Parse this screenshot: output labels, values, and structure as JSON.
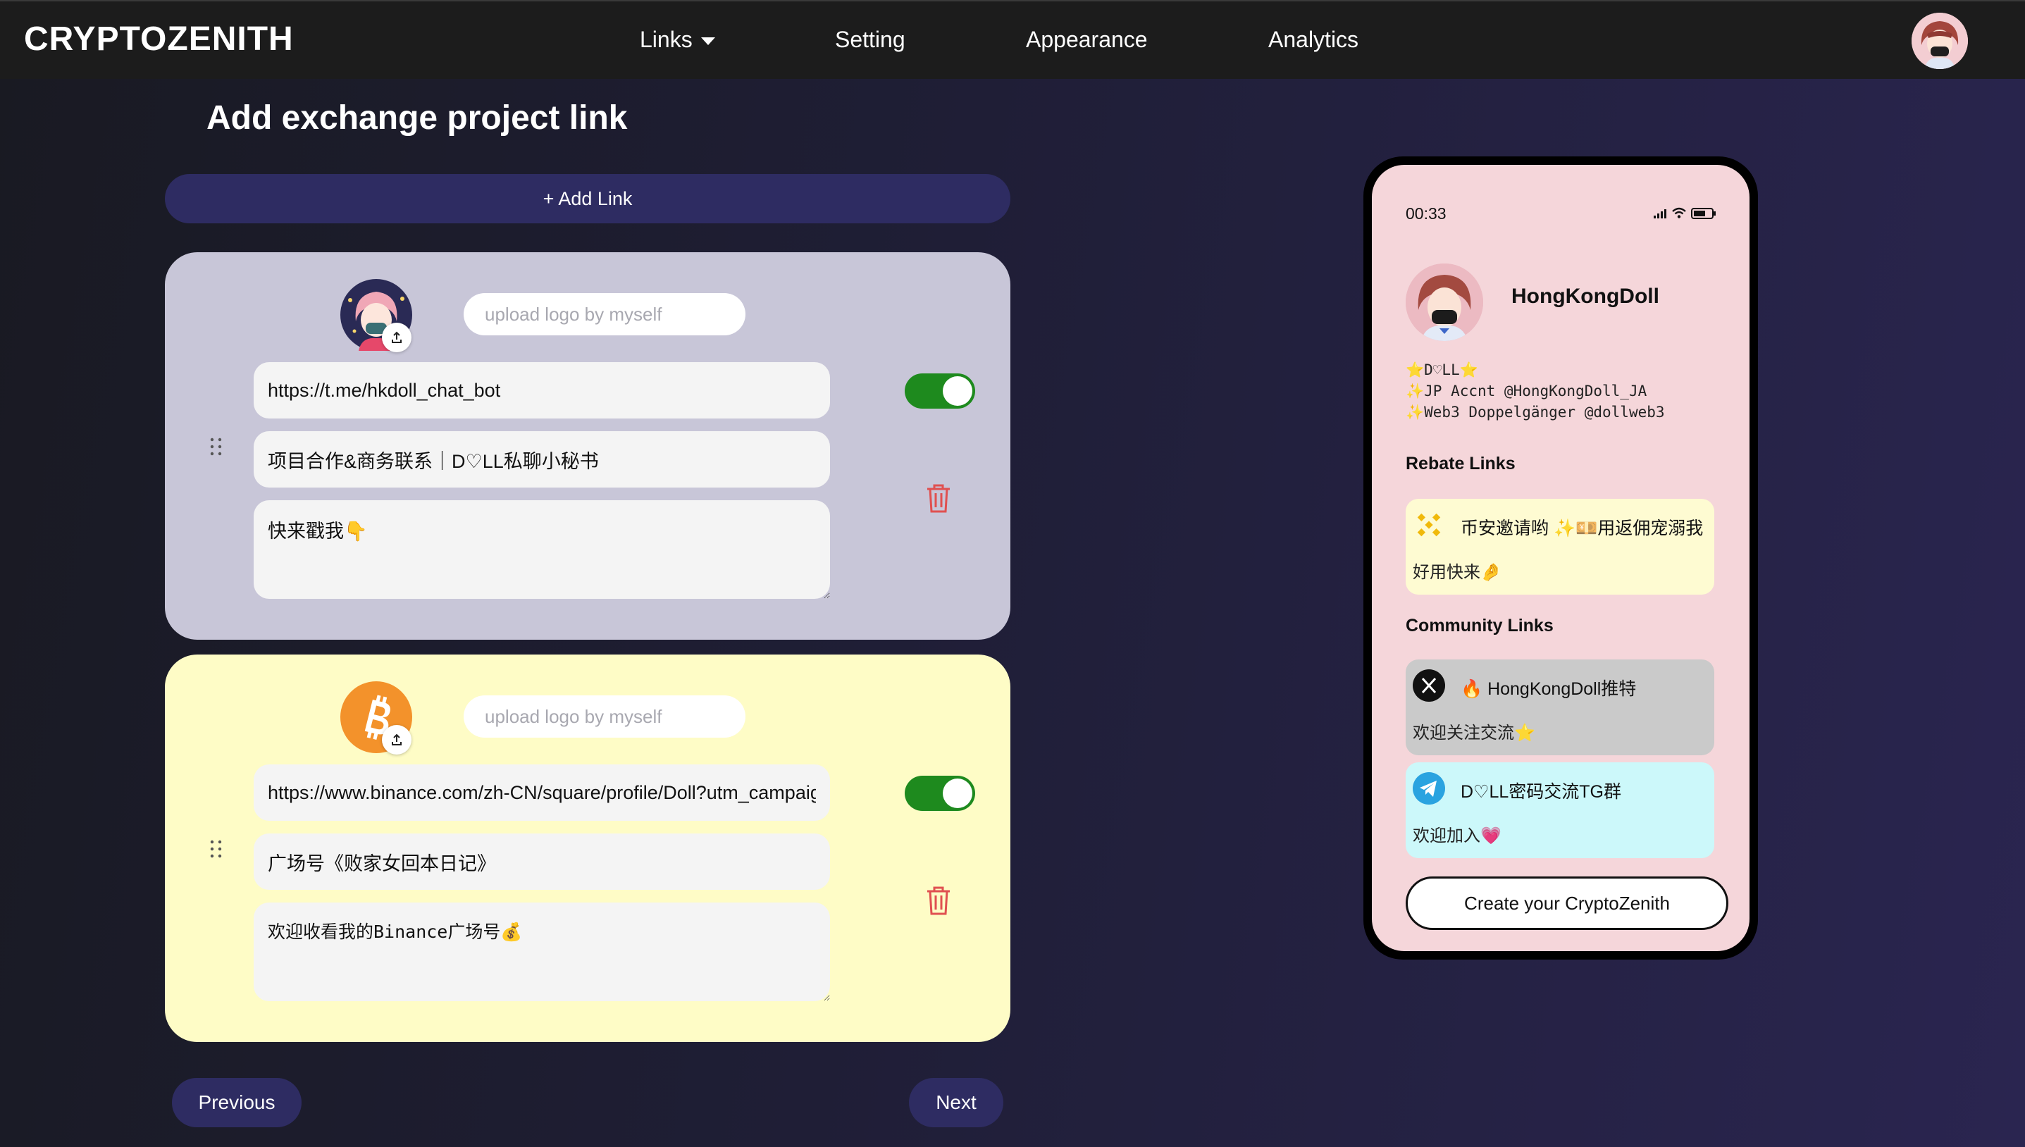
{
  "nav": {
    "brand": "CRYPTOZENITH",
    "links_label": "Links",
    "setting_label": "Setting",
    "appearance_label": "Appearance",
    "analytics_label": "Analytics"
  },
  "editor": {
    "title": "Add exchange project link",
    "add_link_label": "+ Add Link",
    "cards": [
      {
        "upload_placeholder": "upload logo by myself",
        "url": "https://t.me/hkdoll_chat_bot",
        "title": "项目合作&商务联系｜D♡LL私聊小秘书",
        "description": "快来戳我👇",
        "enabled": true
      },
      {
        "upload_placeholder": "upload logo by myself",
        "url": "https://www.binance.com/zh-CN/square/profile/Doll?utm_campaign=a",
        "title": "广场号《败家女回本日记》",
        "description": "欢迎收看我的Binance广场号💰",
        "enabled": true
      }
    ],
    "previous_label": "Previous",
    "next_label": "Next"
  },
  "preview": {
    "time": "00:33",
    "name": "HongKongDoll",
    "bio": "⭐D♡LL⭐\n✨JP Accnt @HongKongDoll_JA\n✨Web3 Doppelgänger @dollweb3",
    "rebate_heading": "Rebate Links",
    "community_heading": "Community Links",
    "rebate_links": [
      {
        "icon": "binance-icon",
        "title": "币安邀请哟 ✨💴用返佣宠溺我",
        "description": "好用快来🤌"
      }
    ],
    "community_links": [
      {
        "icon": "x-icon",
        "title": "🔥 HongKongDoll推特",
        "description": "欢迎关注交流⭐"
      },
      {
        "icon": "telegram-icon",
        "title": "D♡LL密码交流TG群",
        "description": "欢迎加入💗"
      }
    ],
    "create_label": "Create your CryptoZenith"
  },
  "colors": {
    "accent_button": "#2e2c62",
    "toggle_on": "#1e8a1e",
    "card_1_bg": "#c8c6d8",
    "card_2_bg": "#fefcc6",
    "phone_bg": "#f5d6da",
    "trash": "#e05050"
  }
}
